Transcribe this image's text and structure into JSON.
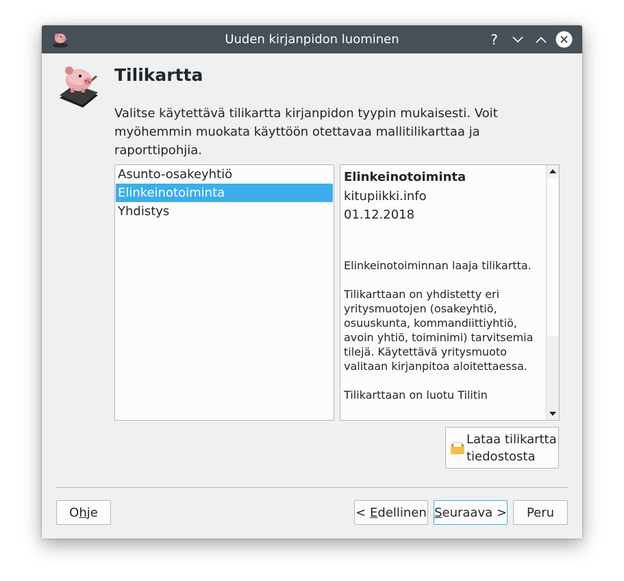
{
  "window": {
    "title": "Uuden kirjanpidon luominen",
    "help_glyph": "?",
    "title_icons": [
      "piggy-bank-app-icon",
      "help-icon",
      "minimize-icon",
      "maximize-icon",
      "close-icon"
    ]
  },
  "page": {
    "title": "Tilikartta",
    "description": "Valitse käytettävä tilikartta kirjanpidon tyypin mukaisesti. Voit myöhemmin muokata käyttöön otettavaa mallitilikarttaa ja raporttipohjia."
  },
  "chart_list": {
    "items": [
      {
        "label": "Asunto-osakeyhtiö",
        "selected": false
      },
      {
        "label": "Elinkeinotoiminta",
        "selected": true
      },
      {
        "label": "Yhdistys",
        "selected": false
      }
    ]
  },
  "info": {
    "title": "Elinkeinotoiminta",
    "author": "kitupiikki.info",
    "date": "01.12.2018",
    "para1": "Elinkeinotoiminnan laaja tilikartta.",
    "para2": "Tilikarttaan on yhdistetty eri yritysmuotojen (osakeyhtiö, osuuskunta, kommandiittiyhtiö, avoin yhtiö, toiminimi) tarvitsemia tilejä. Käytettävä yritysmuoto valitaan kirjanpitoa aloitettaessa.",
    "para3": "Tilikarttaan on luotu Tilitin"
  },
  "buttons": {
    "load_line1": "Lataa tilikartta",
    "load_line2": "tiedostosta",
    "help_pre": "O",
    "help_mn": "h",
    "help_post": "je",
    "back_pre": "< ",
    "back_mn": "E",
    "back_post": "dellinen",
    "next_mn": "S",
    "next_post": "euraava >",
    "cancel": "Peru"
  },
  "colors": {
    "titlebar": "#475057",
    "window_bg": "#eff0f1",
    "selection": "#3daee9",
    "text": "#232629"
  }
}
